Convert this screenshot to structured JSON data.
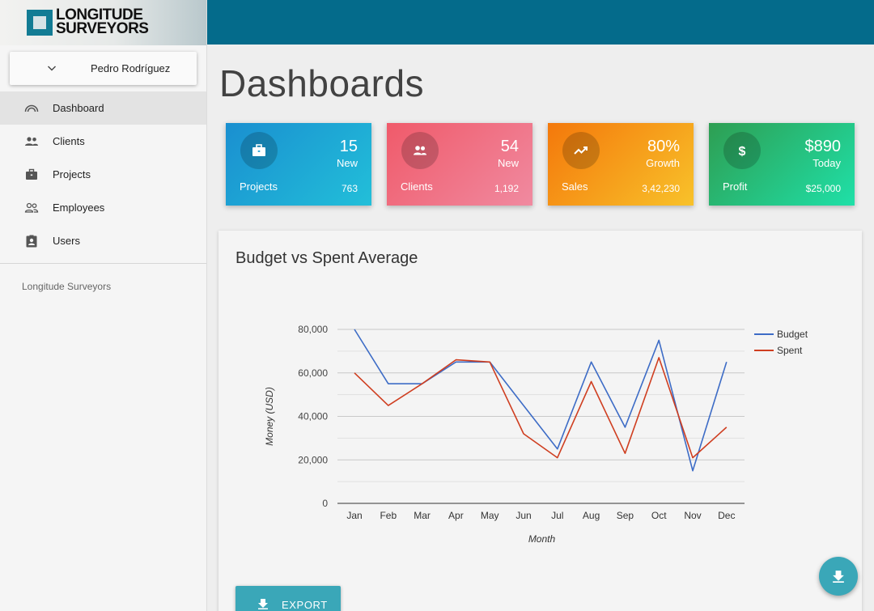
{
  "app": {
    "logo_line1": "LONGITUDE",
    "logo_line2": "SURVEYORS",
    "brand_color": "#046b8b"
  },
  "user": {
    "name": "Pedro Rodríguez",
    "icon": "chevron-down-icon"
  },
  "sidebar": {
    "items": [
      {
        "label": "Dashboard",
        "icon": "dashboard-icon",
        "active": true
      },
      {
        "label": "Clients",
        "icon": "people-icon",
        "active": false
      },
      {
        "label": "Projects",
        "icon": "briefcase-icon",
        "active": false
      },
      {
        "label": "Employees",
        "icon": "people-outline-icon",
        "active": false
      },
      {
        "label": "Users",
        "icon": "badge-icon",
        "active": false
      }
    ],
    "footer": "Longitude Surveyors"
  },
  "page": {
    "title": "Dashboards"
  },
  "cards": [
    {
      "value": "15",
      "sub": "New",
      "label": "Projects",
      "count": "763",
      "icon": "briefcase-icon",
      "gradient_from": "#1a8fd0",
      "gradient_to": "#22bfd9"
    },
    {
      "value": "54",
      "sub": "New",
      "label": "Clients",
      "count": "1,192",
      "icon": "people-icon",
      "gradient_from": "#f05a6a",
      "gradient_to": "#f08aa0"
    },
    {
      "value": "80%",
      "sub": "Growth",
      "label": "Sales",
      "count": "3,42,230",
      "icon": "trending-up-icon",
      "gradient_from": "#f4780b",
      "gradient_to": "#f8c22a"
    },
    {
      "value": "$890",
      "sub": "Today",
      "label": "Profit",
      "count": "$25,000",
      "icon": "dollar-icon",
      "gradient_from": "#2e9e52",
      "gradient_to": "#1fe0a8"
    }
  ],
  "chart_panel": {
    "title": "Budget vs Spent Average"
  },
  "chart_data": {
    "type": "line",
    "title": "Budget vs Spent Average",
    "categories": [
      "Jan",
      "Feb",
      "Mar",
      "Apr",
      "May",
      "Jun",
      "Jul",
      "Aug",
      "Sep",
      "Oct",
      "Nov",
      "Dec"
    ],
    "series": [
      {
        "name": "Budget",
        "color": "#3d6cc6",
        "values": [
          80000,
          55000,
          55000,
          65000,
          65000,
          45000,
          25000,
          65000,
          35000,
          75000,
          15000,
          65000
        ]
      },
      {
        "name": "Spent",
        "color": "#cf3e20",
        "values": [
          60000,
          45000,
          55000,
          66000,
          65000,
          32000,
          21000,
          56000,
          23000,
          67000,
          21000,
          35000
        ]
      }
    ],
    "xlabel": "Month",
    "ylabel": "Money (USD)",
    "ylim": [
      0,
      80000
    ],
    "yticks": [
      0,
      20000,
      40000,
      60000,
      80000
    ],
    "ytick_labels": [
      "0",
      "20,000",
      "40,000",
      "60,000",
      "80,000"
    ],
    "grid": true,
    "legend": "right"
  },
  "actions": {
    "export_label": "EXPORT",
    "fab_icon": "download-icon"
  }
}
